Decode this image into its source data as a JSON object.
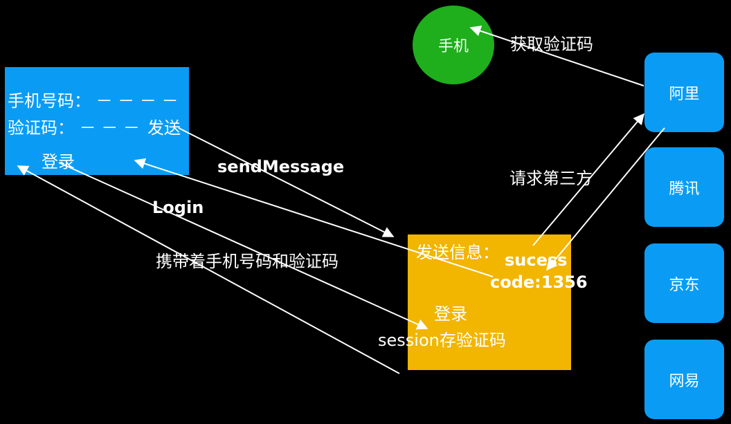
{
  "phone": {
    "label": "手机"
  },
  "get_code_label": "获取验证码",
  "form": {
    "phone_row": "手机号码： － － － －",
    "code_row": "验证码： － － － ",
    "send_label": "发送",
    "login_label": "登录"
  },
  "labels": {
    "send_message": "sendMessage",
    "login": "Login",
    "carry": "携带着手机号码和验证码",
    "request_third_party": "请求第三方"
  },
  "server": {
    "send_info": "发送信息：",
    "success": "sucess",
    "code": "code:1356",
    "login": "登录",
    "session": "session存验证码"
  },
  "providers": [
    "阿里",
    "腾讯",
    "京东",
    "网易"
  ],
  "colors": {
    "background": "#000000",
    "form": "#0a9cf5",
    "server": "#f2b500",
    "phone": "#1fae1c",
    "arrows": "#ffffff"
  }
}
